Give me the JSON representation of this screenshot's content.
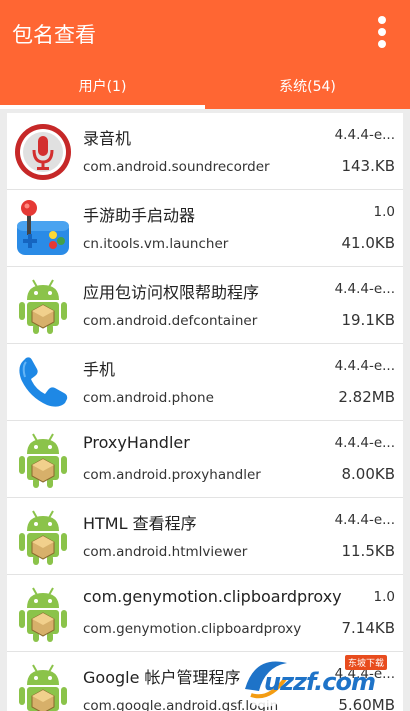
{
  "app": {
    "title": "包名查看"
  },
  "tabs": [
    {
      "label": "用户(1)",
      "selected": true
    },
    {
      "label": "系统(54)",
      "selected": false
    }
  ],
  "apps": [
    {
      "name": "录音机",
      "package": "com.android.soundrecorder",
      "version": "4.4.4-e...",
      "size": "143.KB",
      "icon": "microphone-icon"
    },
    {
      "name": "手游助手启动器",
      "package": "cn.itools.vm.launcher",
      "version": "1.0",
      "size": "41.0KB",
      "icon": "joystick-icon"
    },
    {
      "name": "应用包访问权限帮助程序",
      "package": "com.android.defcontainer",
      "version": "4.4.4-e...",
      "size": "19.1KB",
      "icon": "android-icon"
    },
    {
      "name": "手机",
      "package": "com.android.phone",
      "version": "4.4.4-e...",
      "size": "2.82MB",
      "icon": "phone-icon"
    },
    {
      "name": "ProxyHandler",
      "package": "com.android.proxyhandler",
      "version": "4.4.4-e...",
      "size": "8.00KB",
      "icon": "android-icon"
    },
    {
      "name": "HTML 查看程序",
      "package": "com.android.htmlviewer",
      "version": "4.4.4-e...",
      "size": "11.5KB",
      "icon": "android-icon"
    },
    {
      "name": "com.genymotion.clipboardproxy",
      "package": "com.genymotion.clipboardproxy",
      "version": "1.0",
      "size": "7.14KB",
      "icon": "android-icon"
    },
    {
      "name": "Google 帐户管理程序",
      "package": "com.google.android.gsf.login",
      "version": "4.4.4-e...",
      "size": "5.60MB",
      "icon": "android-icon"
    }
  ],
  "watermark": {
    "text": "uzzf.com",
    "badge": "东坡下载"
  }
}
